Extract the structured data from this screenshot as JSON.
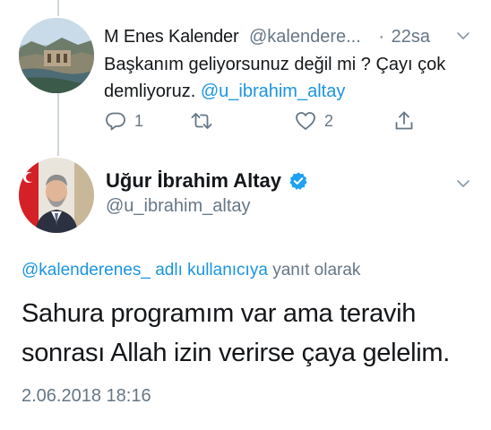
{
  "reply_tweet": {
    "name": "M Enes Kalender",
    "handle": "@kalendere...",
    "time": "22sa",
    "text": "Başkanım geliyorsunuz değil mi ? Çayı çok demliyoruz.",
    "mention": "@u_ibrahim_altay",
    "reply_count": "1",
    "like_count": "2",
    "icons": [
      "reply-icon",
      "retweet-icon",
      "like-icon",
      "share-icon",
      "chevron-down-icon"
    ]
  },
  "main_tweet": {
    "name": "Uğur İbrahim Altay",
    "handle": "@u_ibrahim_altay",
    "replying_link": "@kalenderenes_ adlı kullanıcıya",
    "replying_suffix": "yanıt olarak",
    "text": "Sahura programım var ama teravih sonrası Allah izin verirse çaya gelelim.",
    "timestamp": "2.06.2018 18:16",
    "verified_icon": "verified-badge-icon"
  },
  "colors": {
    "link": "#1b95e0",
    "secondary_text": "#657786",
    "primary_text": "#14171a",
    "thread_line": "#ccd6dd"
  }
}
